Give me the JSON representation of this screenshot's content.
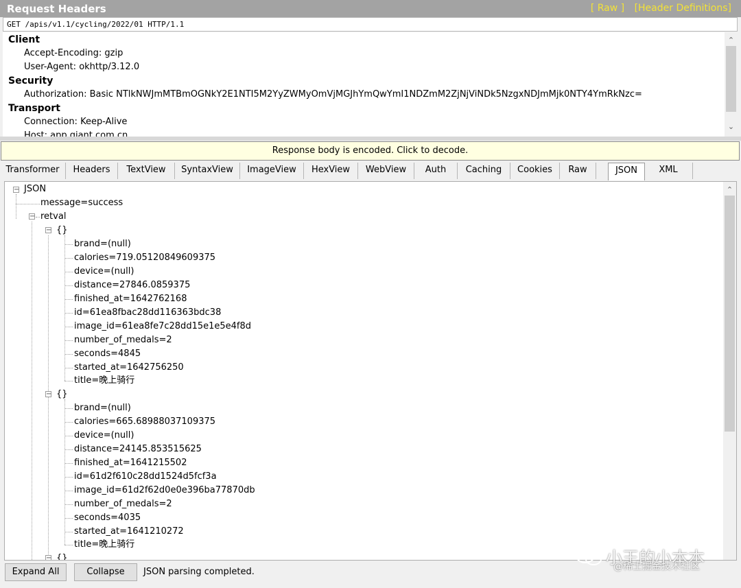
{
  "request_headers": {
    "title": "Request Headers",
    "links": [
      "[ Raw ]",
      "[Header Definitions]"
    ],
    "request_line": "GET /apis/v1.1/cycling/2022/01 HTTP/1.1",
    "groups": [
      {
        "name": "Client",
        "items": [
          "Accept-Encoding: gzip",
          "User-Agent: okhttp/3.12.0"
        ]
      },
      {
        "name": "Security",
        "items": [
          "Authorization: Basic NTlkNWJmMTBmOGNkY2E1NTI5M2YyZWMyOmVjMGJhYmQwYmI1NDZmM2ZjNjViNDk5NzgxNDJmMjk0NTY4YmRkNzc="
        ]
      },
      {
        "name": "Transport",
        "items": [
          "Connection: Keep-Alive",
          "Host: app.giant.com.cn"
        ]
      }
    ]
  },
  "banner": "Response body is encoded. Click to decode.",
  "tabs": [
    "Transformer",
    "Headers",
    "TextView",
    "SyntaxView",
    "ImageView",
    "HexView",
    "WebView",
    "Auth",
    "Caching",
    "Cookies",
    "Raw",
    "JSON",
    "XML"
  ],
  "active_tab": "JSON",
  "tree": {
    "root": "JSON",
    "message": "message=success",
    "retval": "retval",
    "obj_label": "{}",
    "records": [
      [
        "brand=(null)",
        "calories=719.05120849609375",
        "device=(null)",
        "distance=27846.0859375",
        "finished_at=1642762168",
        "id=61ea8fbac28dd116363bdc38",
        "image_id=61ea8fe7c28dd15e1e5e4f8d",
        "number_of_medals=2",
        "seconds=4845",
        "started_at=1642756250",
        "title=晚上骑行"
      ],
      [
        "brand=(null)",
        "calories=665.68988037109375",
        "device=(null)",
        "distance=24145.853515625",
        "finished_at=1641215502",
        "id=61d2f610c28dd1524d5fcf3a",
        "image_id=61d2f62d0e0e396ba77870db",
        "number_of_medals=2",
        "seconds=4035",
        "started_at=1641210272",
        "title=晚上骑行"
      ]
    ]
  },
  "bottom": {
    "expand_label": "Expand All",
    "collapse_label": "Collapse",
    "status": "JSON parsing completed."
  },
  "watermark": {
    "main": "小王的小本本",
    "sub": "@稀土掘金技术社区"
  },
  "colors": {
    "header_bar": "#a3a3a3",
    "header_link": "#f3e236",
    "banner_bg": "#ffffe1"
  }
}
